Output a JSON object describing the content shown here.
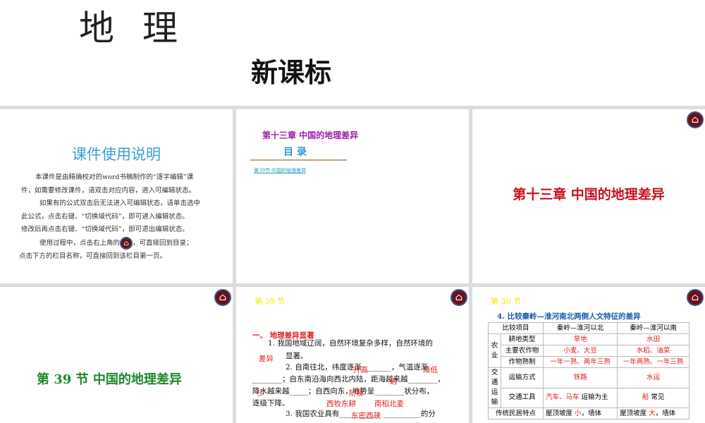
{
  "header": {
    "subject": "地理",
    "standard": "新课标"
  },
  "p1": {
    "title": "课件使用说明",
    "lines": [
      "本课件是由精确校对的word书稿制作的“逐字编辑”课",
      "件，如需要修改课件，请双击对应内容，进入可编辑状态。",
      "如果有的公式双击后无法进入可编辑状态，请单击选中",
      "此公式，点击右键、“切换域代码”，即可进入编辑状态。",
      "修改后再点击右键、“切换域代码”，即可退出编辑状态。",
      "使用过程中，点击右上角的",
      "，可直接回到目录；",
      "点击下方的栏目名称，可直接回到该栏目第一页。"
    ]
  },
  "p2": {
    "chapter": "第十三章  中国的地理差异",
    "toc": "目  录",
    "link": "第39节  中国的地理差异"
  },
  "p3": {
    "title": "第十三章   中国的地理差异"
  },
  "p4": {
    "title": "第 39 节   中国的地理差异"
  },
  "p5": {
    "section": "第 39 节",
    "heading_num": "一、",
    "heading": "地理差异显著",
    "l1": "1. 我国地域辽阔，自然环境复杂多样，自然环境的",
    "a1": "差异",
    "l1b": "显著。",
    "l2": "2. 自南往北，纬度逐渐________，气温逐渐",
    "a2": "升高",
    "a3": "降低",
    "l3": "________；自东南沿海向西北内陆，距海越来越________，",
    "a4": "远",
    "l4": "降水越来越_____；自西向东，地势呈________状分布，",
    "a5": "少",
    "a6": "阶梯",
    "l5": "逐级下降。",
    "a7": "西牧东耕",
    "a8": "南稻北麦",
    "l6": "3. 我国农业具有__________、__________的分",
    "a9": "东密西疏"
  },
  "p6": {
    "section": "第 39 节",
    "title": "4. 比较秦岭—淮河南北两侧人文特征的差异",
    "headers": [
      "比较项目",
      "秦岭—淮河以北",
      "秦岭—淮河以南"
    ],
    "groups": [
      "农业",
      "交通运输",
      "传统民居特点"
    ],
    "rows": [
      [
        "耕地类型",
        "旱地",
        "水田"
      ],
      [
        "主要农作物",
        "小麦、大豆",
        "水稻、油菜"
      ],
      [
        "作物熟制",
        "一年一熟、两年三熟",
        "一年两熟、一年三熟"
      ],
      [
        "运输方式",
        "铁路",
        "水运"
      ],
      [
        "交通工具",
        "汽车、马车",
        "船"
      ]
    ],
    "tool_n_suffix": "运输为主",
    "tool_s_suffix": "常见",
    "roof_label": "屋顶坡度",
    "roof_n": "小",
    "roof_s": "大",
    "wall": "，墙体"
  }
}
